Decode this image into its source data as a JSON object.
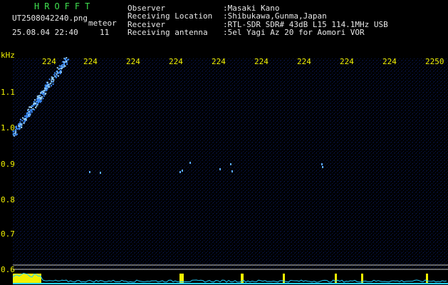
{
  "header": {
    "brand": "HROFFT",
    "filename": "UT2508042240.png",
    "mode": "meteor",
    "datetime": "25.08.04 22:40",
    "count": "11",
    "info": [
      {
        "label": "Observer",
        "value": ":Masaki Kano"
      },
      {
        "label": "Receiving Location",
        "value": ":Shibukawa,Gunma,Japan"
      },
      {
        "label": "Receiver",
        "value": ":RTL-SDR SDR# 43dB L15 114.1MHz USB"
      },
      {
        "label": "Receiving antenna",
        "value": ":5el Yagi Az 20 for Aomori VOR"
      }
    ]
  },
  "axes": {
    "y_unit": "kHz",
    "y_ticks": [
      "1.1",
      "1.0",
      "0.9",
      "0.8",
      "0.7",
      "0.6"
    ],
    "x_ticks": [
      "224",
      "224",
      "224",
      "224",
      "224",
      "224",
      "224",
      "224",
      "224",
      "2250"
    ]
  },
  "colors": {
    "background": "#000000",
    "noise": "#0a1440",
    "meteor": "#4aa8ff",
    "text_green": "#3fe04f",
    "text_yellow": "#f2f200",
    "text_white": "#e8e8e8",
    "level_trace": "#22d0ff"
  }
}
